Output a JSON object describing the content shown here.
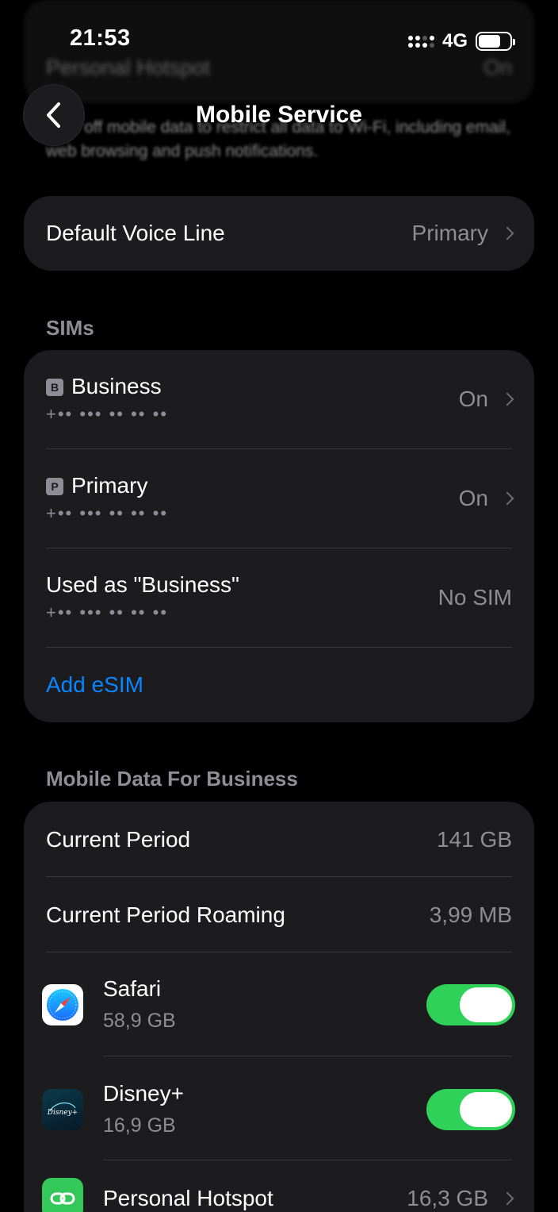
{
  "background_scroll": {
    "ghost_row_label": "Personal Hotspot",
    "ghost_row_value": "On",
    "footer_text": "Turn off mobile data to restrict all data to Wi-Fi, including email, web browsing and push notifications."
  },
  "status_bar": {
    "time": "21:53",
    "network": "4G"
  },
  "nav": {
    "title": "Mobile Service"
  },
  "default_voice_line": {
    "label": "Default Voice Line",
    "value": "Primary"
  },
  "sims": {
    "header": "SIMs",
    "items": [
      {
        "badge": "B",
        "name": "Business",
        "number": "+•• ••• •• •• ••",
        "status": "On"
      },
      {
        "badge": "P",
        "name": "Primary",
        "number": "+•• ••• •• •• ••",
        "status": "On"
      },
      {
        "name": "Used as \"Business\"",
        "number": "+•• ••• •• •• ••",
        "status": "No SIM"
      }
    ],
    "add_label": "Add eSIM"
  },
  "mobile_data": {
    "header": "Mobile Data For Business",
    "current_period": {
      "label": "Current Period",
      "value": "141 GB"
    },
    "current_period_roaming": {
      "label": "Current Period Roaming",
      "value": "3,99 MB"
    },
    "apps": [
      {
        "name": "Safari",
        "usage": "58,9 GB",
        "enabled": true,
        "icon": "safari-icon"
      },
      {
        "name": "Disney+",
        "usage": "16,9 GB",
        "enabled": true,
        "icon": "disney-plus-icon"
      },
      {
        "name": "Personal Hotspot",
        "usage": "16,3 GB",
        "icon": "hotspot-icon"
      }
    ]
  },
  "colors": {
    "background": "#000000",
    "card": "#1c1c1e",
    "accent_blue": "#0a84ff",
    "toggle_on": "#30d158",
    "secondary_text": "#8d8d93"
  }
}
